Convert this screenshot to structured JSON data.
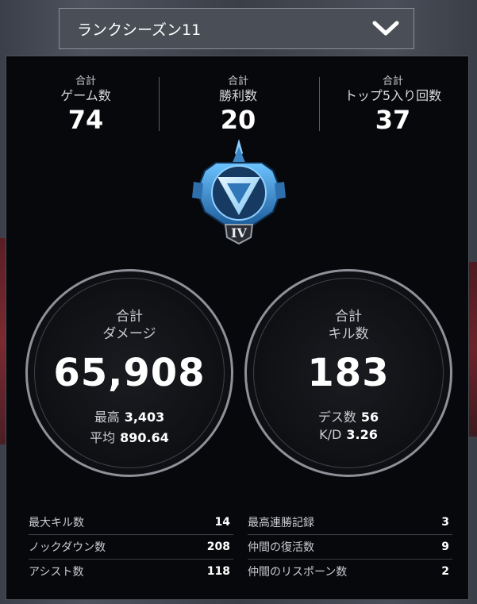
{
  "season_selector": {
    "label": "ランクシーズン11"
  },
  "top_stats": [
    {
      "sub": "合計",
      "label": "ゲーム数",
      "value": "74"
    },
    {
      "sub": "合計",
      "label": "勝利数",
      "value": "20"
    },
    {
      "sub": "合計",
      "label": "トップ5入り回数",
      "value": "37"
    }
  ],
  "rank_badge": {
    "tier": "IV",
    "icon": "diamond-rank-badge-icon",
    "accent": "#4aa3e8"
  },
  "damage": {
    "sub": "合計",
    "label": "ダメージ",
    "value": "65,908",
    "max_label": "最高",
    "max_value": "3,403",
    "avg_label": "平均",
    "avg_value": "890.64"
  },
  "kills": {
    "sub": "合計",
    "label": "キル数",
    "value": "183",
    "deaths_label": "デス数",
    "deaths_value": "56",
    "kd_label": "K/D",
    "kd_value": "3.26"
  },
  "left_table": [
    {
      "label": "最大キル数",
      "value": "14"
    },
    {
      "label": "ノックダウン数",
      "value": "208"
    },
    {
      "label": "アシスト数",
      "value": "118"
    }
  ],
  "right_table": [
    {
      "label": "最高連勝記録",
      "value": "3"
    },
    {
      "label": "仲間の復活数",
      "value": "9"
    },
    {
      "label": "仲間のリスポーン数",
      "value": "2"
    }
  ]
}
